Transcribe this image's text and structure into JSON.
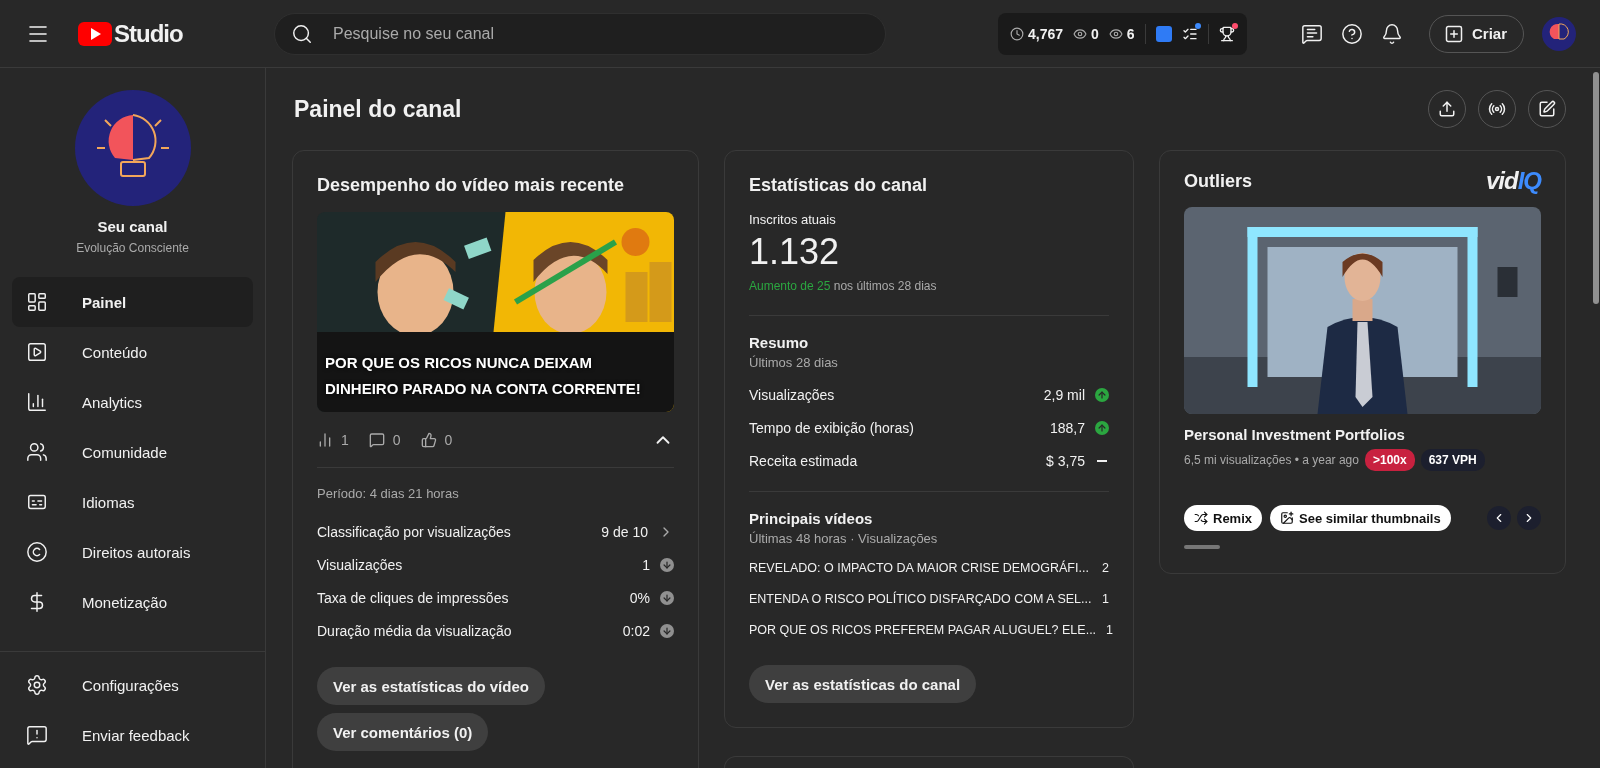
{
  "header": {
    "brand": "Studio",
    "search": {
      "placeholder": "Pesquise no seu canal"
    },
    "vidiq_stats": [
      {
        "kind": "clock",
        "value": "4,767"
      },
      {
        "kind": "eye",
        "value": "0"
      },
      {
        "kind": "eye",
        "value": "6"
      }
    ],
    "create_button": "Criar"
  },
  "sidebar": {
    "channel_name": "Seu canal",
    "channel_handle": "Evolução Consciente",
    "items": [
      {
        "kind": "dashboard",
        "label": "Painel",
        "selected": true
      },
      {
        "kind": "content",
        "label": "Conteúdo",
        "selected": false
      },
      {
        "kind": "analytics",
        "label": "Analytics",
        "selected": false
      },
      {
        "kind": "community",
        "label": "Comunidade",
        "selected": false
      },
      {
        "kind": "languages",
        "label": "Idiomas",
        "selected": false
      },
      {
        "kind": "copyright",
        "label": "Direitos autorais",
        "selected": false
      },
      {
        "kind": "money",
        "label": "Monetização",
        "selected": false
      }
    ],
    "footer_items": [
      {
        "kind": "settings",
        "label": "Configurações"
      },
      {
        "kind": "feedback",
        "label": "Enviar feedback"
      }
    ]
  },
  "page_title": "Painel do canal",
  "latest_video": {
    "title": "Desempenho do vídeo mais recente",
    "thumbnail": {
      "kind": "picture"
    },
    "video_title": "POR QUE OS RICOS NUNCA DEIXAM DINHEIRO PARADO NA CONTA CORRENTE!",
    "metrics": [
      {
        "kind": "views",
        "value": "1"
      },
      {
        "kind": "comments",
        "value": "0"
      },
      {
        "kind": "likes",
        "value": "0"
      }
    ],
    "period": "Período: 4 dias 21 horas",
    "rows": [
      {
        "label": "Classificação por visualizações",
        "value": "9 de 10",
        "kind": "link"
      },
      {
        "label": "Visualizações",
        "value": "1",
        "kind": "down"
      },
      {
        "label": "Taxa de cliques de impressões",
        "value": "0%",
        "kind": "down"
      },
      {
        "label": "Duração média da visualização",
        "value": "0:02",
        "kind": "down"
      }
    ],
    "buttons": [
      "Ver as estatísticas do vídeo",
      "Ver comentários (0)"
    ]
  },
  "channel_stats": {
    "title": "Estatísticas do canal",
    "subscribers_label": "Inscritos atuais",
    "subscribers": "1.132",
    "change_highlight": "Aumento de 25",
    "change_rest": "nos últimos 28 dias",
    "summary_title": "Resumo",
    "summary_period": "Últimos 28 dias",
    "summary_rows": [
      {
        "label": "Visualizações",
        "value": "2,9 mil",
        "kind": "up"
      },
      {
        "label": "Tempo de exibição (horas)",
        "value": "188,7",
        "kind": "up"
      },
      {
        "label": "Receita estimada",
        "value": "$ 3,75",
        "kind": "none"
      }
    ],
    "top_title": "Principais vídeos",
    "top_period": "Últimas 48 horas · Visualizações",
    "top_videos": [
      {
        "title": "REVELADO: O IMPACTO DA MAIOR CRISE DEMOGRÁFI...",
        "views": "2"
      },
      {
        "title": "ENTENDA O RISCO POLÍTICO DISFARÇADO COM A SEL...",
        "views": "1"
      },
      {
        "title": "POR QUE OS RICOS PREFEREM PAGAR ALUGUEL? ELE...",
        "views": "1"
      }
    ],
    "button": "Ver as estatísticas do canal"
  },
  "outliers": {
    "title": "Outliers",
    "logo": [
      "vid",
      "IQ"
    ],
    "thumbnail": {
      "kind": "picture"
    },
    "video_title": "Personal Investment Portfolios",
    "meta": "6,5 mi visualizações • a year ago",
    "badges": [
      {
        "text": ">100x",
        "color": "#c8213f"
      },
      {
        "text": "637 VPH",
        "color": "#1c1f2e"
      }
    ],
    "actions": [
      {
        "kind": "remix",
        "label": "Remix"
      },
      {
        "kind": "thumbnails",
        "label": "See similar thumbnails"
      }
    ]
  }
}
